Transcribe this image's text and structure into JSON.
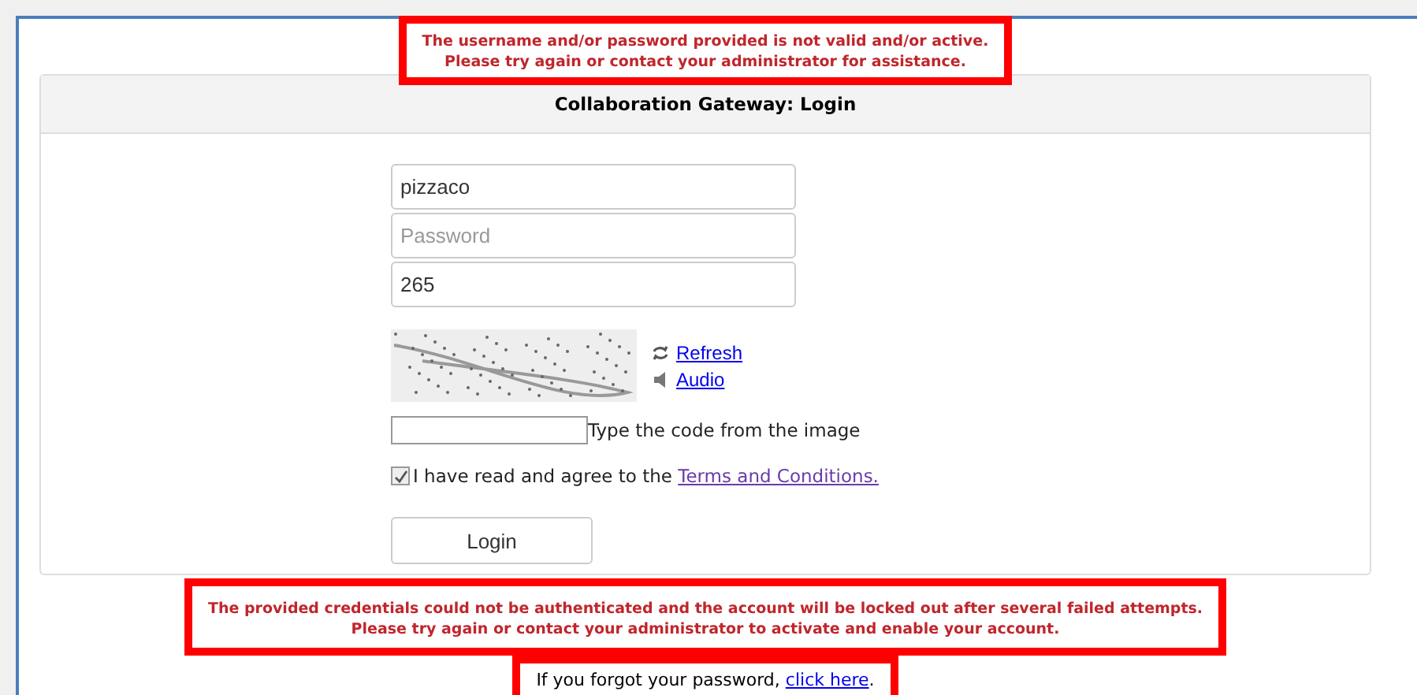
{
  "error_top": {
    "lines": [
      "The username and/or password provided is not valid and/or active.",
      "Please try again or contact your administrator for assistance."
    ]
  },
  "panel": {
    "title": "Collaboration Gateway: Login"
  },
  "fields": [
    {
      "kind": "text",
      "value": "pizzaco"
    },
    {
      "kind": "password",
      "placeholder": "Password"
    },
    {
      "kind": "text",
      "value": "265"
    }
  ],
  "captcha": {
    "refresh": "Refresh",
    "audio": "Audio",
    "code_hint": "Type the code from the image"
  },
  "terms": {
    "checked": true,
    "text": "I have read and agree to the",
    "link": "Terms and Conditions."
  },
  "login_button": "Login",
  "error_bottom": {
    "lines": [
      "The provided credentials could not be authenticated and the account will be locked out after several failed attempts.",
      "Please try again or contact your administrator to activate and enable your account."
    ]
  },
  "forgot": {
    "text": "If you forgot your password,",
    "link": "click here",
    "end": "."
  }
}
